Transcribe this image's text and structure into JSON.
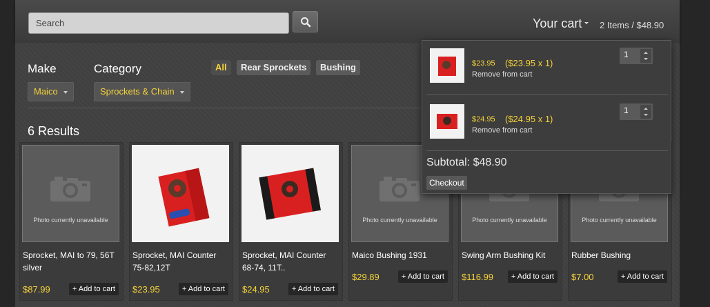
{
  "search": {
    "placeholder": "Search"
  },
  "cart": {
    "label": "Your cart",
    "summary": "2 Items / $48.90",
    "items": [
      {
        "unit_price": "$23.95",
        "calc": "($23.95 x 1)",
        "remove": "Remove from cart",
        "qty": "1"
      },
      {
        "unit_price": "$24.95",
        "calc": "($24.95 x 1)",
        "remove": "Remove from cart",
        "qty": "1"
      }
    ],
    "subtotal": "Subtotal: $48.90",
    "checkout": "Checkout"
  },
  "filters": {
    "make_label": "Make",
    "make_value": "Maico",
    "category_label": "Category",
    "category_value": "Sprockets & Chain",
    "chips": [
      "All",
      "Rear Sprockets",
      "Bushing"
    ]
  },
  "results": "6 Results",
  "products": [
    {
      "title": "Sprocket, MAI to 79, 56T silver",
      "price": "$87.99",
      "add": "+ Add to cart",
      "photo": "Photo currently unavailable"
    },
    {
      "title": "Sprocket, MAI Counter 75-82,12T",
      "price": "$23.95",
      "add": "+ Add to cart"
    },
    {
      "title": "Sprocket, MAI Counter 68-74, 11T..",
      "price": "$24.95",
      "add": "+ Add to cart"
    },
    {
      "title": "Maico Bushing 1931",
      "price": "$29.89",
      "add": "+ Add to cart",
      "photo": "Photo currently unavailable"
    },
    {
      "title": "Swing Arm Bushing Kit",
      "price": "$116.99",
      "add": "+ Add to cart",
      "photo": "Photo currently unavailable"
    },
    {
      "title": "Rubber Bushing",
      "price": "$7.00",
      "add": "+ Add to cart",
      "photo": "Photo currently unavailable"
    }
  ],
  "colors": {
    "accent": "#f5d23a",
    "panel": "#404040",
    "topbar": "#454545"
  },
  "icons": {
    "search": "search-icon",
    "camera": "camera-icon",
    "caret": "caret-down-icon",
    "spinner": "spinner-arrows-icon"
  }
}
